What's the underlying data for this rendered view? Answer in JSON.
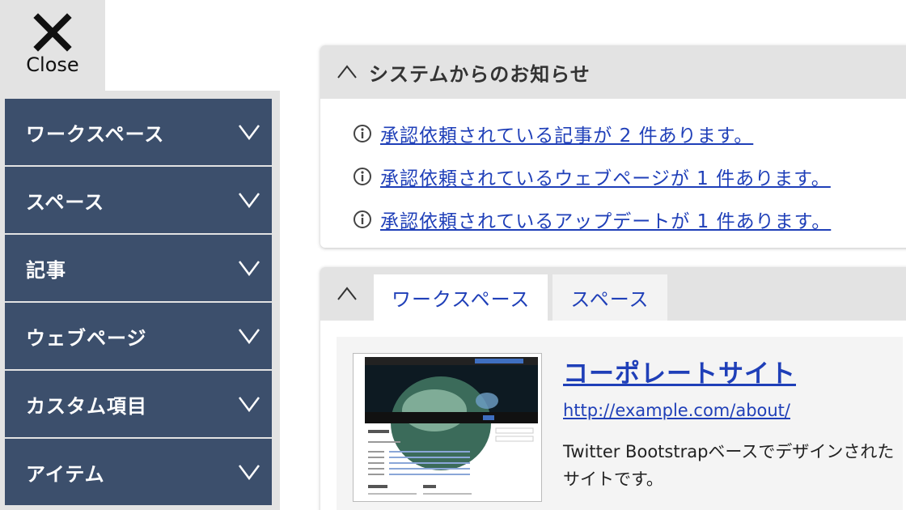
{
  "close": {
    "label": "Close",
    "icon": "close-icon"
  },
  "sidebar": {
    "items": [
      {
        "label": "ワークスペース"
      },
      {
        "label": "スペース"
      },
      {
        "label": "記事"
      },
      {
        "label": "ウェブページ"
      },
      {
        "label": "カスタム項目"
      },
      {
        "label": "アイテム"
      }
    ]
  },
  "notices": {
    "title": "システムからのお知らせ",
    "items": [
      {
        "text": "承認依頼されている記事が 2 件あります。"
      },
      {
        "text": "承認依頼されているウェブページが 1 件あります。"
      },
      {
        "text": "承認依頼されているアップデートが 1 件あります。"
      }
    ]
  },
  "workspace_panel": {
    "tabs": [
      {
        "label": "ワークスペース",
        "active": true
      },
      {
        "label": "スペース",
        "active": false
      }
    ],
    "site": {
      "title": "コーポレートサイト",
      "url": "http://example.com/about/",
      "description": "Twitter Bootstrapベースでデザインされたサイトです。"
    }
  },
  "colors": {
    "sidebar_bg": "#3c4f6c",
    "link": "#1f3fb8",
    "header_bg": "#e3e3e3"
  }
}
